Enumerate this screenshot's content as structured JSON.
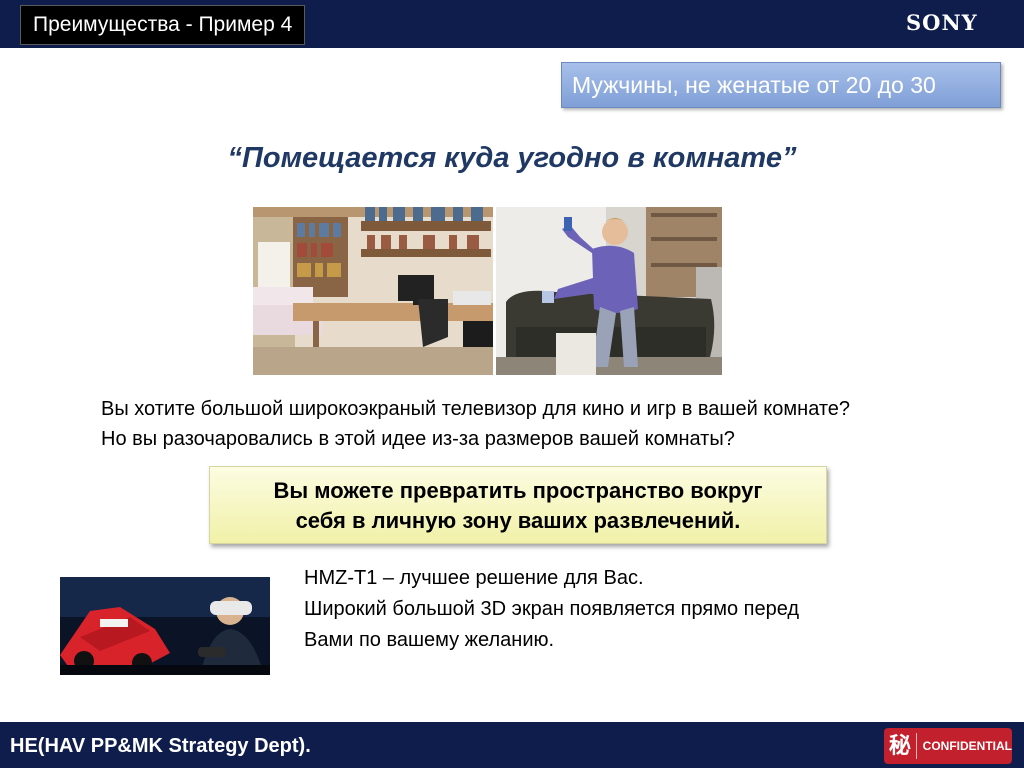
{
  "header": {
    "title": "Преимущества - Пример 4",
    "brand": "SONY"
  },
  "segment_label": "Мужчины, не женатые от 20 до 30",
  "quote": "“Помещается куда угодно в комнате”",
  "question": {
    "line1": "Вы хотите большой широкоэкраный телевизор для кино и игр в вашей комнате?",
    "line2": "Но вы разочаровались в этой идее из-за размеров вашей комнаты?"
  },
  "callout": {
    "line1": "Вы можете превратить пространство вокруг",
    "line2": "себя в личную зону ваших развлечений."
  },
  "product": {
    "line1": "HMZ-T1 – лучшее решение для Вас.",
    "line2": "Широкий большой 3D экран появляется прямо перед",
    "line3": "Вами по вашему желанию."
  },
  "footer": {
    "department": "HE(HAV PP&MK Strategy Dept).",
    "confidential_glyph": "秘",
    "confidential_label": "CONFIDENTIAL"
  },
  "colors": {
    "bar": "#0f1d4d",
    "segment_bg": "#8fabe0",
    "quote_text": "#1f3864",
    "callout_bg": "#f5f5b8",
    "confidential_bg": "#c2202c"
  },
  "icons": [
    "room-photo",
    "person-playing-photo",
    "hmz-t1-racing-photo",
    "confidential-seal-icon"
  ]
}
